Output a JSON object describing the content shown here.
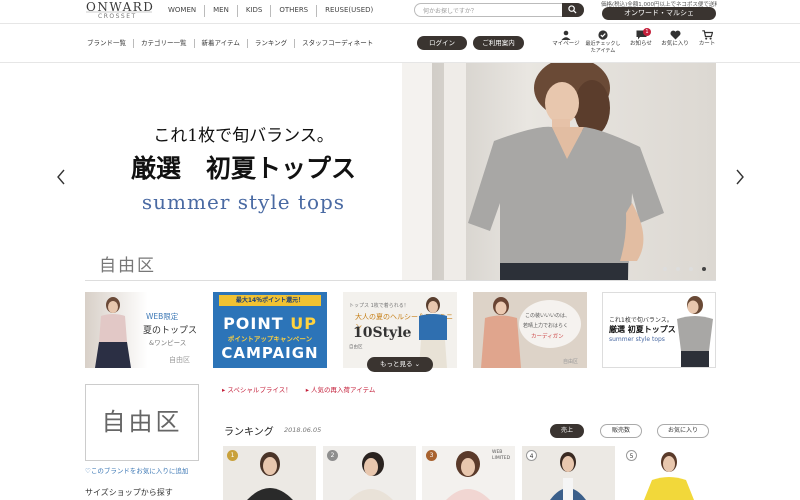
{
  "header": {
    "logo_main": "ONWARD",
    "logo_sub": "CROSSET",
    "nav": [
      "WOMEN",
      "MEN",
      "KIDS",
      "OTHERS",
      "REUSE(USED)"
    ],
    "search_placeholder": "何かお探しですか？",
    "notice": "価格(税込)全額1,000円以上でネコポス便で送料",
    "marche_label": "オンワード・マルシェ"
  },
  "subnav": {
    "links": [
      "ブランド一覧",
      "カテゴリー一覧",
      "新着アイテム",
      "ランキング",
      "スタッフコーディネート"
    ],
    "login_label": "ログイン",
    "guide_label": "ご利用案内",
    "icons": [
      {
        "name": "user-icon",
        "label": "マイページ"
      },
      {
        "name": "check-icon",
        "label": "最近チェックしたアイテム"
      },
      {
        "name": "message-icon",
        "label": "お知らせ",
        "badge": "1"
      },
      {
        "name": "heart-icon",
        "label": "お気に入り"
      },
      {
        "name": "cart-icon",
        "label": "カート"
      }
    ]
  },
  "hero": {
    "line1": "これ1枚で旬バランス。",
    "line2": "厳選　初夏トップス",
    "line3": "summer style tops",
    "brand": "自由区",
    "slides": 4,
    "active_slide": 4
  },
  "thumbs": {
    "t1": {
      "l1": "WEB限定",
      "l2": "夏のトップス",
      "l3": "&ワンピース",
      "l4": "自由区"
    },
    "t2": {
      "bar": "最大14％ポイント還元！",
      "l1a": "POINT ",
      "l1b": "UP",
      "l2": "ポイントアップキャンペーン",
      "l3": "CAMPAIGN"
    },
    "t3": {
      "l1": "トップス 1枚で着られる！",
      "l2": "大人の夏のヘルシー＆フェミニン",
      "l3": "10Style",
      "l4": "自由区"
    },
    "t4": {
      "l1": "この装いいいのは、",
      "l2": "若晴上力でおはらく",
      "l3": "カーディガン",
      "l4": "自由区"
    },
    "t5": {
      "l1": "これ1枚で旬バランス。",
      "l2": "厳選 初夏トップス",
      "l3": "summer style tops"
    },
    "more_label": "もっと見る"
  },
  "sidebar": {
    "brand": "自由区",
    "fav_label": "このブランドをお気に入りに追加",
    "size_label": "サイズショップから探す"
  },
  "links": [
    "スペシャルプライス！",
    "人気の再入荷アイテム"
  ],
  "ranking": {
    "title": "ランキング",
    "date": "2018.06.05",
    "tabs": [
      "売上",
      "販売数",
      "お気に入り"
    ],
    "active_tab": 0,
    "items": [
      {
        "rank": "1",
        "badge_color": "#c9a13b"
      },
      {
        "rank": "2",
        "badge_color": "#8e8e8e"
      },
      {
        "rank": "3",
        "badge_color": "#a8622f"
      },
      {
        "rank": "4",
        "badge_color": "#ffffff"
      },
      {
        "rank": "5",
        "badge_color": "#ffffff"
      }
    ],
    "web_limited": "WEB LIMITED"
  },
  "colors": {
    "dark": "#3a3430",
    "accent_red": "#c41f3a",
    "link_blue": "#3d78b5"
  }
}
